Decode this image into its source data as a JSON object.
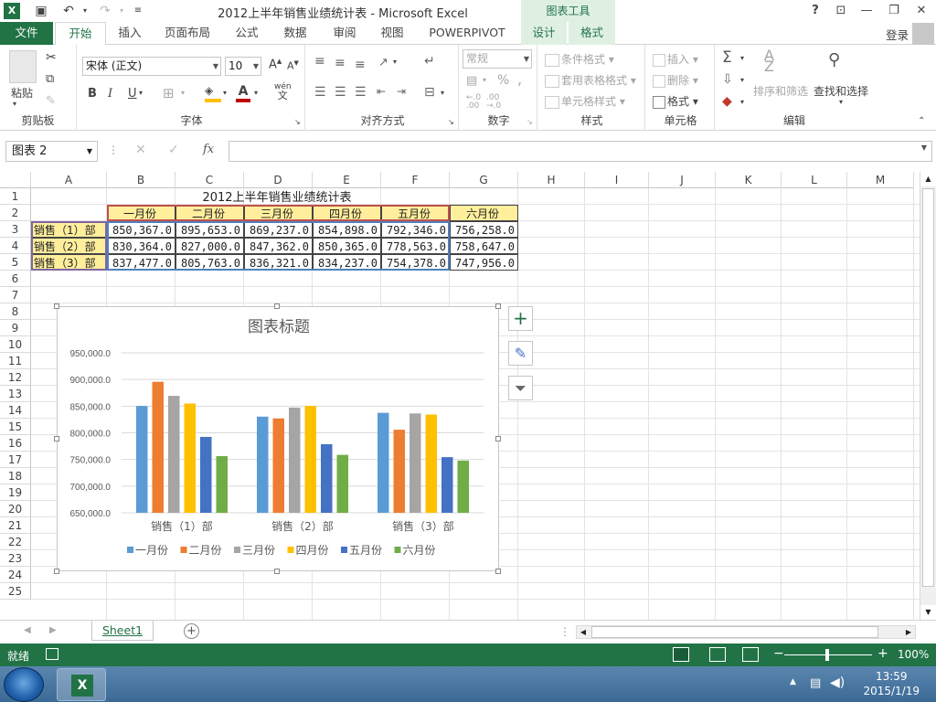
{
  "window": {
    "title": "2012上半年销售业绩统计表 - Microsoft Excel",
    "context_tool": "图表工具",
    "help": "?",
    "app_icon": "X"
  },
  "tabs": [
    "文件",
    "开始",
    "插入",
    "页面布局",
    "公式",
    "数据",
    "审阅",
    "视图",
    "POWERPIVOT",
    "设计",
    "格式"
  ],
  "login": "登录",
  "ribbon": {
    "clipboard": {
      "paste": "粘贴",
      "label": "剪贴板"
    },
    "font": {
      "name": "宋体 (正文)",
      "size": "10",
      "label": "字体",
      "bold": "B",
      "italic": "I",
      "underline": "U",
      "wen": "wén"
    },
    "align": {
      "label": "对齐方式"
    },
    "number": {
      "format": "常规",
      "label": "数字",
      "percent": "%",
      "comma": ","
    },
    "styles": {
      "cond": "条件格式",
      "table": "套用表格格式",
      "cell": "单元格样式",
      "label": "样式"
    },
    "cells": {
      "insert": "插入",
      "delete": "删除",
      "format": "格式",
      "label": "单元格"
    },
    "edit": {
      "sort": "排序和筛选",
      "find": "查找和选择",
      "label": "编辑"
    }
  },
  "namebox": "图表 2",
  "fx": "fx",
  "columns": [
    "A",
    "B",
    "C",
    "D",
    "E",
    "F",
    "G",
    "H",
    "I",
    "J",
    "K",
    "L",
    "M"
  ],
  "rows": [
    "1",
    "2",
    "3",
    "4",
    "5",
    "6",
    "7",
    "8",
    "9",
    "10",
    "11",
    "12",
    "13",
    "14",
    "15",
    "16",
    "17",
    "18",
    "19",
    "20",
    "21",
    "22",
    "23",
    "24",
    "25"
  ],
  "table": {
    "title": "2012上半年销售业绩统计表",
    "months": [
      "一月份",
      "二月份",
      "三月份",
      "四月份",
      "五月份",
      "六月份"
    ],
    "rows": [
      {
        "label": "销售（1）部",
        "values": [
          "850,367.0",
          "895,653.0",
          "869,237.0",
          "854,898.0",
          "792,346.0",
          "756,258.0"
        ]
      },
      {
        "label": "销售（2）部",
        "values": [
          "830,364.0",
          "827,000.0",
          "847,362.0",
          "850,365.0",
          "778,563.0",
          "758,647.0"
        ]
      },
      {
        "label": "销售（3）部",
        "values": [
          "837,477.0",
          "805,763.0",
          "836,321.0",
          "834,237.0",
          "754,378.0",
          "747,956.0"
        ]
      }
    ]
  },
  "chart_data": {
    "type": "bar",
    "title": "图表标题",
    "categories": [
      "销售（1）部",
      "销售（2）部",
      "销售（3）部"
    ],
    "series": [
      {
        "name": "一月份",
        "color": "#5b9bd5",
        "values": [
          850367,
          830364,
          837477
        ]
      },
      {
        "name": "二月份",
        "color": "#ed7d31",
        "values": [
          895653,
          827000,
          805763
        ]
      },
      {
        "name": "三月份",
        "color": "#a5a5a5",
        "values": [
          869237,
          847362,
          836321
        ]
      },
      {
        "name": "四月份",
        "color": "#ffc000",
        "values": [
          854898,
          850365,
          834237
        ]
      },
      {
        "name": "五月份",
        "color": "#4472c4",
        "values": [
          792346,
          778563,
          754378
        ]
      },
      {
        "name": "六月份",
        "color": "#70ad47",
        "values": [
          756258,
          758647,
          747956
        ]
      }
    ],
    "ylim": [
      650000,
      950000
    ],
    "yticks": [
      "950,000.0",
      "900,000.0",
      "850,000.0",
      "800,000.0",
      "750,000.0",
      "700,000.0",
      "650,000.0"
    ],
    "grid": true,
    "legend": "bottom"
  },
  "sheet_tab": "Sheet1",
  "status": {
    "ready": "就绪",
    "zoom": "100%"
  },
  "taskbar": {
    "time": "13:59",
    "date": "2015/1/19"
  },
  "colors": {
    "excel_green": "#217346",
    "header_fill": "#ffef9c"
  }
}
